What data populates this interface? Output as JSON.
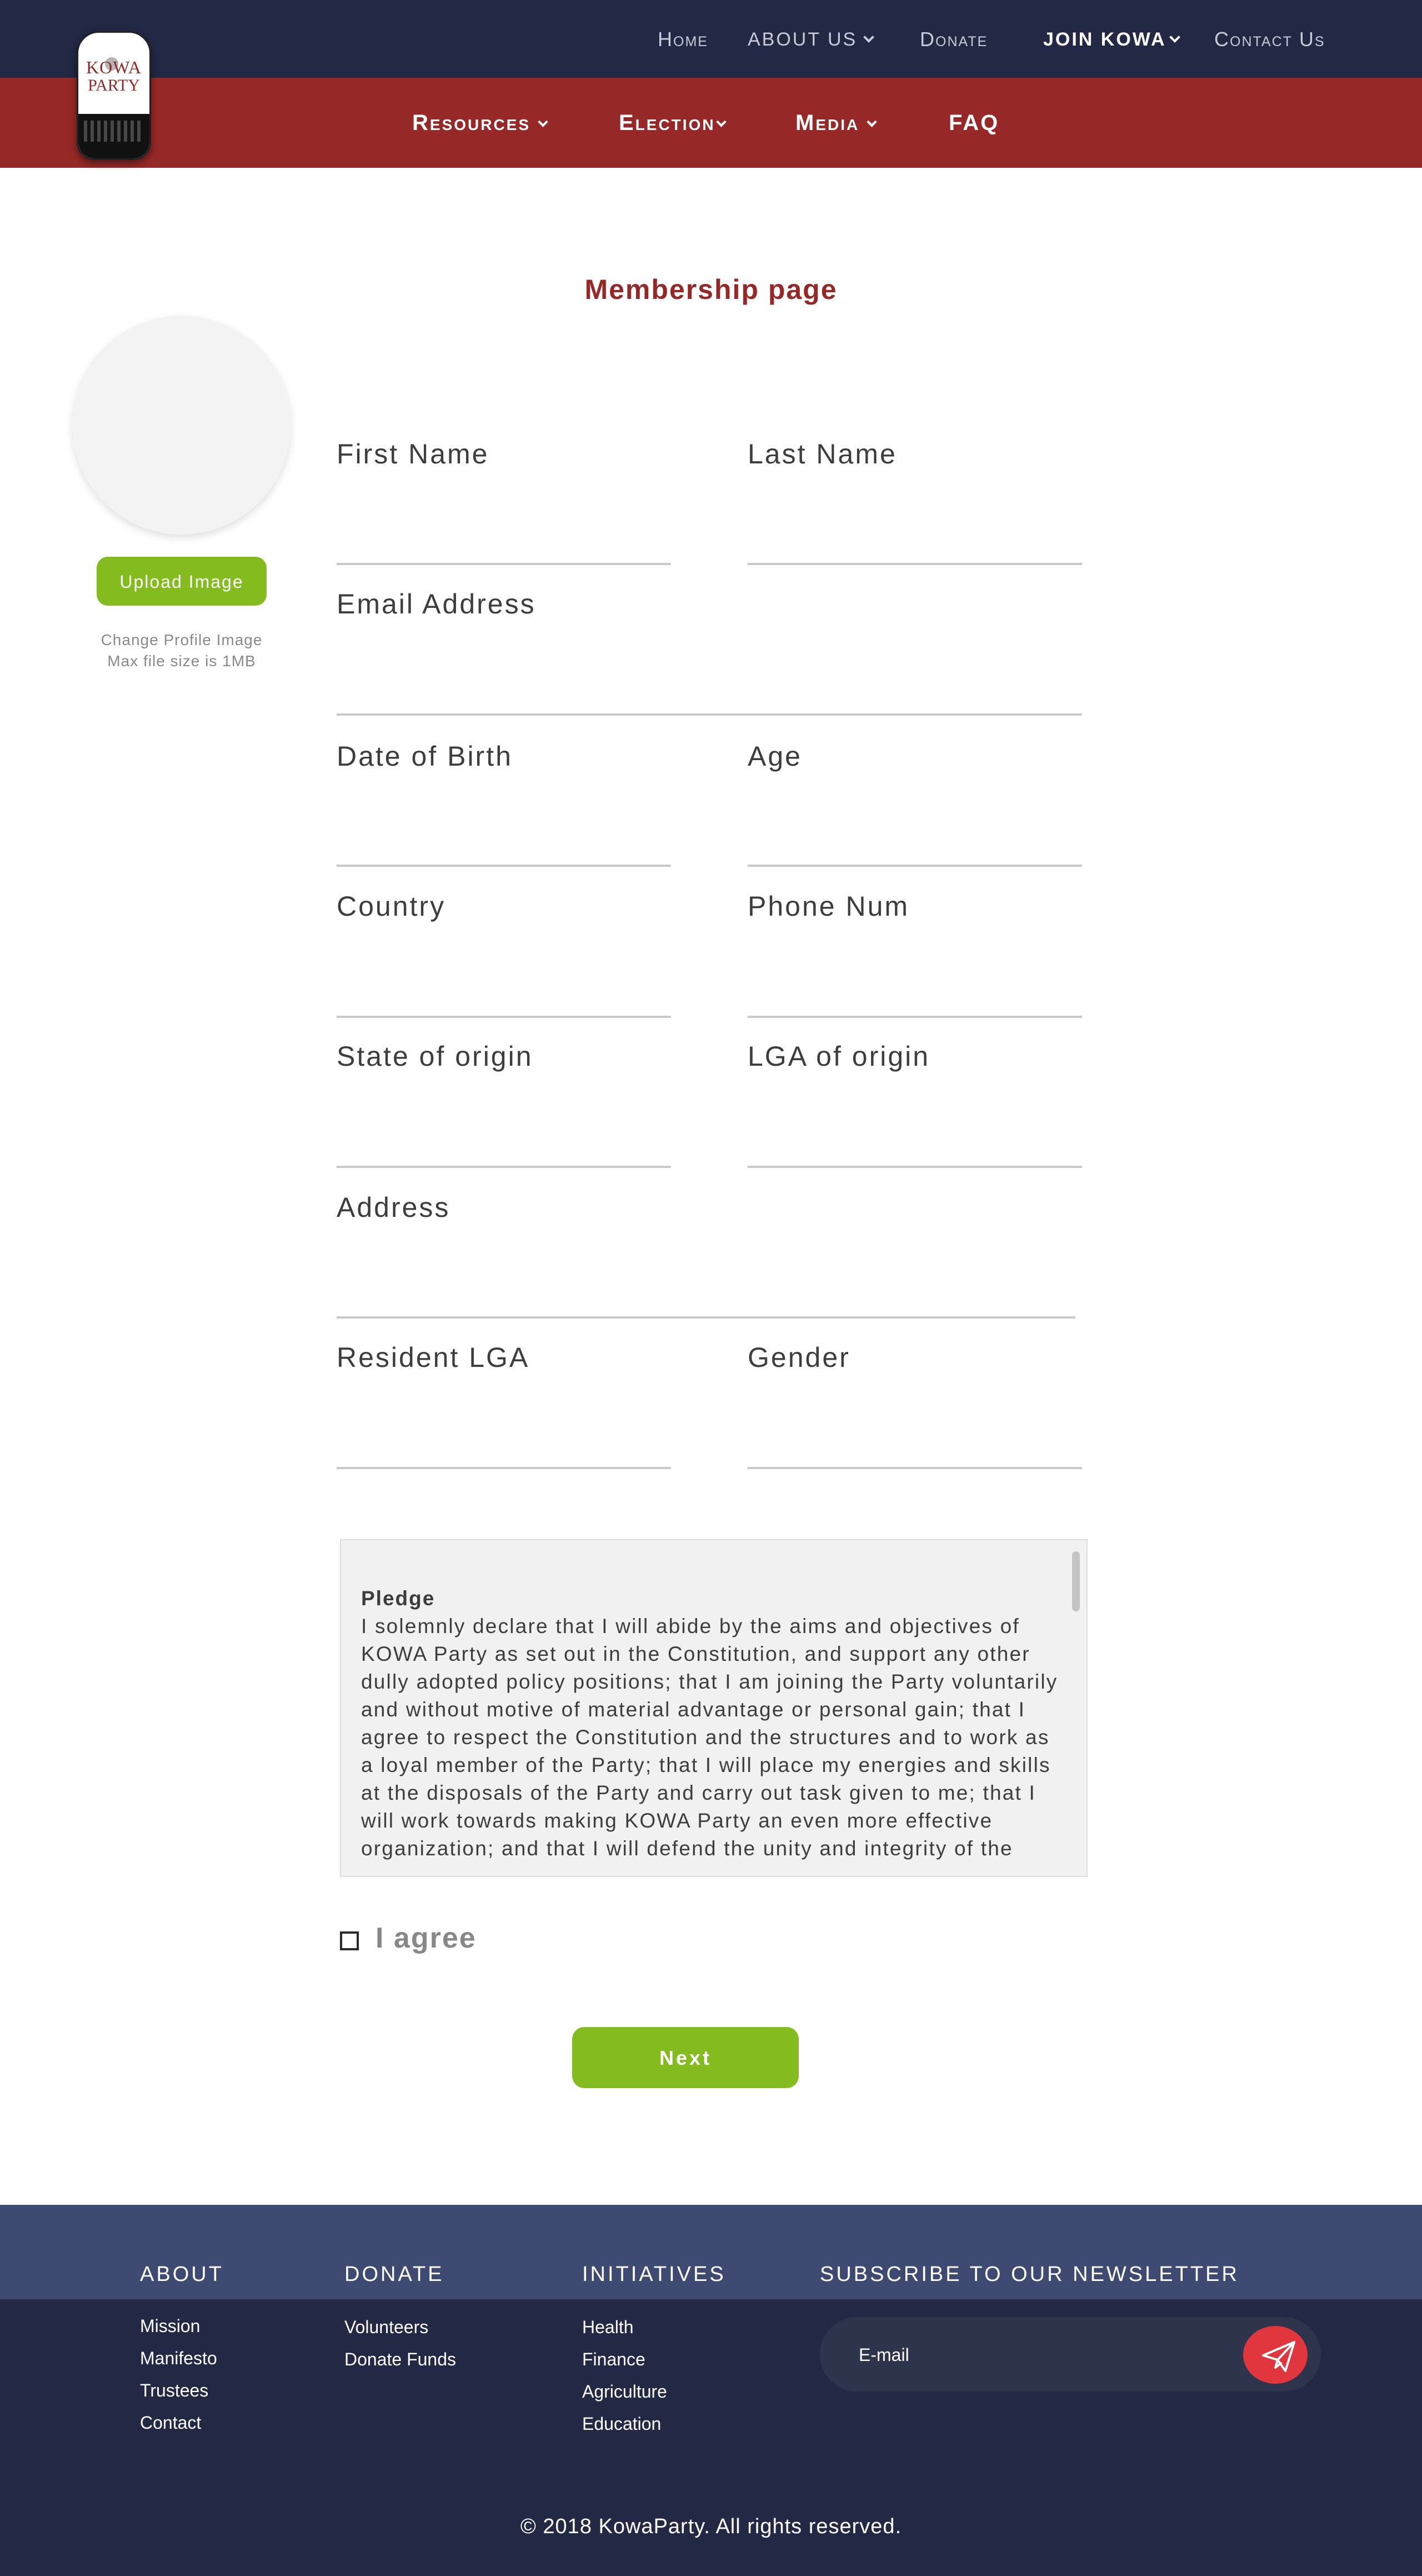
{
  "brand": {
    "logo_line1": "KOWA",
    "logo_line2": "PARTY"
  },
  "top_nav": {
    "home": "Home",
    "about": "ABOUT US",
    "donate": "Donate",
    "join": "JOIN KOWA",
    "contact": "Contact Us"
  },
  "sub_nav": {
    "resources": "Resources",
    "election": "Election",
    "media": "Media",
    "faq": "FAQ"
  },
  "page_title": "Membership page",
  "profile": {
    "upload_label": "Upload Image",
    "hint_line1": "Change Profile Image",
    "hint_line2": "Max file size is 1MB"
  },
  "form": {
    "first_name": "First Name",
    "last_name": "Last Name",
    "email": "Email Address",
    "dob": "Date of Birth",
    "age": "Age",
    "country": "Country",
    "phone": "Phone Num",
    "state": "State of origin",
    "lga": "LGA of origin",
    "address": "Address",
    "resident_lga": "Resident LGA",
    "gender": "Gender"
  },
  "pledge": {
    "heading": "Pledge",
    "body": "I solemnly declare that I will abide by the aims and objectives of KOWA Party as set out in the Constitution, and support any other dully adopted policy positions; that I am joining the Party voluntarily and without motive of material advantage or personal gain; that I agree to respect the Constitution and the structures and to work as a loyal member of the Party; that I will place my energies and skills at the disposals of the Party and carry out task given to me; that I will work towards making KOWA Party an even more effective organization; and that I will defend the unity and integrity of the"
  },
  "agree_label": "I agree",
  "next_label": "Next",
  "footer": {
    "about": {
      "heading": "ABOUT",
      "links": [
        "Mission",
        "Manifesto",
        "Trustees",
        "Contact"
      ]
    },
    "donate": {
      "heading": "DONATE",
      "links": [
        "Volunteers",
        "Donate Funds"
      ]
    },
    "initiatives": {
      "heading": "INITIATIVES",
      "links": [
        "Health",
        "Finance",
        "Agriculture",
        "Education"
      ]
    },
    "newsletter": {
      "heading": "SUBSCRIBE TO OUR NEWSLETTER",
      "placeholder": "E-mail",
      "send_icon": "paper-plane-icon"
    },
    "copyright": "© 2018 KowaParty. All rights reserved."
  },
  "colors": {
    "navy": "#232845",
    "crimson": "#962927",
    "green": "#84bb1e",
    "footer_band": "#3f4a72",
    "send_button": "#e2363e"
  }
}
